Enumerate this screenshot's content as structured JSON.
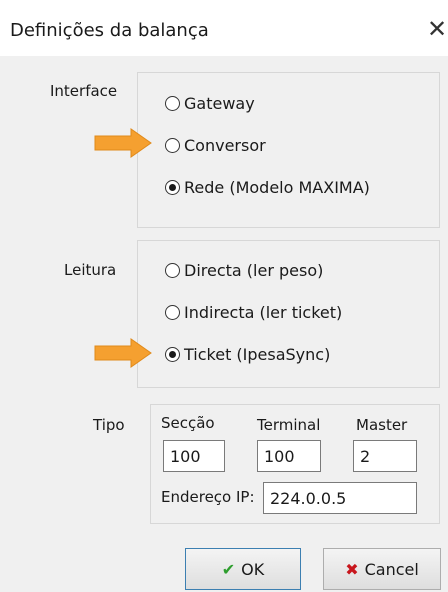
{
  "window": {
    "title": "Definições da balança",
    "close_glyph": "✕"
  },
  "interface": {
    "label": "Interface",
    "options": [
      {
        "label": "Gateway",
        "selected": false
      },
      {
        "label": "Conversor",
        "selected": false
      },
      {
        "label": "Rede (Modelo MAXIMA)",
        "selected": true
      }
    ]
  },
  "leitura": {
    "label": "Leitura",
    "options": [
      {
        "label": "Directa (ler peso)",
        "selected": false
      },
      {
        "label": "Indirecta (ler ticket)",
        "selected": false
      },
      {
        "label": "Ticket (IpesaSync)",
        "selected": true
      }
    ]
  },
  "tipo": {
    "label": "Tipo",
    "seccao": {
      "label": "Secção",
      "value": "100"
    },
    "terminal": {
      "label": "Terminal",
      "value": "100"
    },
    "master": {
      "label": "Master",
      "value": "2"
    },
    "ip": {
      "label": "Endereço IP:",
      "value": "224.0.0.5"
    }
  },
  "buttons": {
    "ok": {
      "label": "OK",
      "icon": "checkmark-icon",
      "icon_color": "#2e9e2e"
    },
    "cancel": {
      "label": "Cancel",
      "icon": "x-icon",
      "icon_color": "#c8161d"
    }
  },
  "colors": {
    "arrow": "#f5a030",
    "background": "#f0f0f0"
  },
  "annotations": [
    "arrow-conversor",
    "arrow-ticket"
  ]
}
